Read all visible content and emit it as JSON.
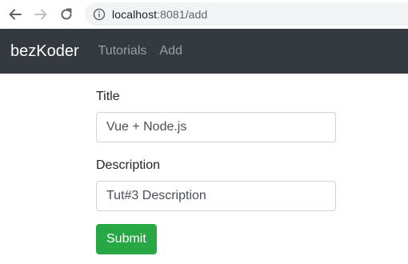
{
  "browser": {
    "icons": {
      "back": "back-arrow-icon",
      "forward": "forward-arrow-icon",
      "reload": "reload-icon",
      "info": "info-icon"
    },
    "url_host": "localhost",
    "url_rest": ":8081/add"
  },
  "navbar": {
    "brand": "bezKoder",
    "links": [
      "Tutorials",
      "Add"
    ]
  },
  "form": {
    "title_label": "Title",
    "title_value": "Vue + Node.js",
    "description_label": "Description",
    "description_value": "Tut#3 Description",
    "submit_label": "Submit"
  },
  "colors": {
    "navbar_bg": "#343a40",
    "submit_bg": "#28a745"
  }
}
